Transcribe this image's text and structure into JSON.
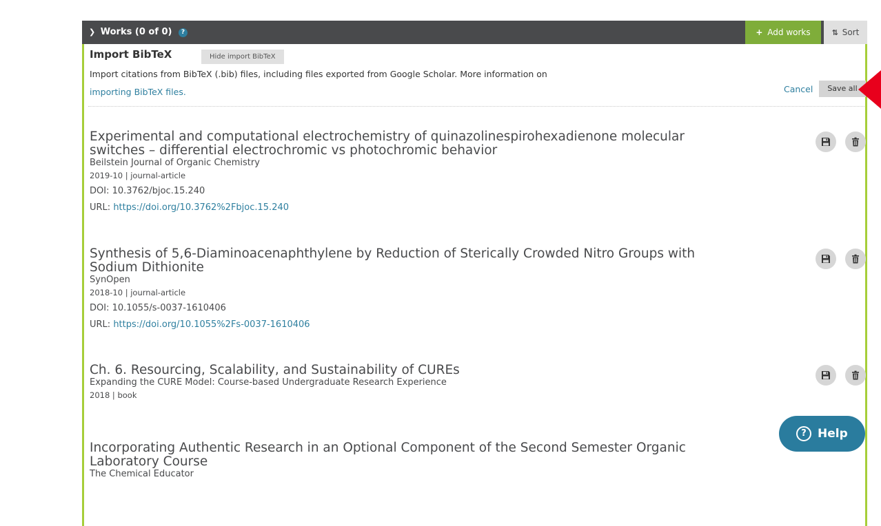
{
  "works_header": {
    "title": "Works (0 of 0)",
    "help_icon": "?",
    "add_works_label": "Add works",
    "sort_label": "Sort"
  },
  "import_bibtex": {
    "title": "Import BibTeX",
    "hide_label": "Hide import BibTeX",
    "description": "Import citations from BibTeX (.bib) files, including files exported from Google Scholar. More information on",
    "link_text": "importing BibTeX files.",
    "cancel_label": "Cancel",
    "save_all_label": "Save all"
  },
  "works": [
    {
      "title": "Experimental and computational electrochemistry of quinazolinespirohexadienone molecular switches – differential electrochromic vs photochromic behavior",
      "journal": "Beilstein Journal of Organic Chemistry",
      "meta": "2019-10 | journal-article",
      "doi": "DOI: 10.3762/bjoc.15.240",
      "url_prefix": "URL: ",
      "url": "https://doi.org/10.3762%2Fbjoc.15.240"
    },
    {
      "title": "Synthesis of 5,6-Diaminoacenaphthylene by Reduction of Sterically Crowded Nitro Groups with Sodium Dithionite",
      "journal": "SynOpen",
      "meta": "2018-10 | journal-article",
      "doi": "DOI: 10.1055/s-0037-1610406",
      "url_prefix": "URL: ",
      "url": "https://doi.org/10.1055%2Fs-0037-1610406"
    },
    {
      "title": "Ch. 6. Resourcing, Scalability, and Sustainability of CUREs",
      "journal": "Expanding the CURE Model: Course-based Undergraduate Research Experience",
      "meta": "2018 | book"
    },
    {
      "title": "Incorporating Authentic Research in an Optional Component of the Second Semester Organic Laboratory Course",
      "journal": "The Chemical Educator"
    }
  ],
  "help_button": {
    "label": "Help",
    "icon": "?"
  },
  "colors": {
    "header_bg": "#494a4c",
    "accent_green": "#7fad3a",
    "border_green": "#a6ce39",
    "link_blue": "#2e7f9f",
    "annotation_red": "#e8001c",
    "help_bg": "#2a7c9e"
  }
}
